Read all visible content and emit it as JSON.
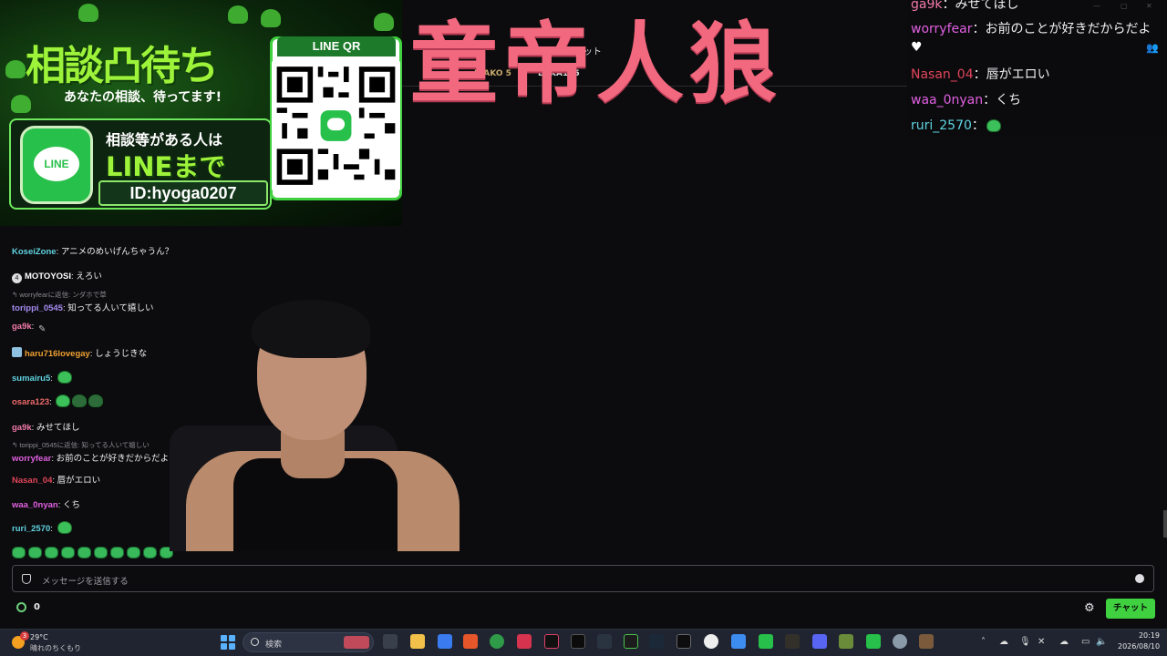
{
  "colors": {
    "accent": "#3fd13f",
    "title": "#f2687f",
    "line_green": "#27c04a",
    "background": "#0c0c0e"
  },
  "overlay_title": "童帝人狼",
  "header": {
    "chat_label": "チャット",
    "ranks": [
      {
        "name": "RIAKO",
        "count": "5"
      },
      {
        "name": "BEKA145",
        "count": ""
      }
    ]
  },
  "banner": {
    "title": "相談凸待ち",
    "subtitle": "あなたの相談、待ってます!",
    "line1": "相談等がある人は",
    "line2": "LINEまで",
    "id": "ID:hyoga0207",
    "qr_label": "LINE QR",
    "logo_text": "LINE"
  },
  "chat": {
    "messages": [
      {
        "user": "KoseiZone",
        "text": "アニメのめいげんちゃうん？",
        "color": "#5fd3e0"
      },
      {
        "user": "MOTOYOSI",
        "text": "えろい",
        "color": "#ffffff",
        "badge": "4"
      },
      {
        "reply": "worryfearに返信: ンダホで草"
      },
      {
        "user": "torippi_0545",
        "text": "知ってる人いて嬉しい",
        "color": "#a48cf0"
      },
      {
        "user": "ga9k",
        "text": "",
        "color": "#f27aa8",
        "emote": "pen"
      },
      {
        "user": "haru716lovegay",
        "text": "しょうじきな",
        "color": "#f0a030",
        "avatar": true
      },
      {
        "user": "sumairu5",
        "text": "",
        "color": "#5fd3e0",
        "emote": "ghost"
      },
      {
        "user": "osara123",
        "text": "",
        "color": "#f06a6a",
        "emote": "frogs"
      },
      {
        "user": "ga9k",
        "text": "みせてほし",
        "color": "#f27aa8"
      },
      {
        "reply": "torippi_0545に返信: 知ってる人いて嬉しい"
      },
      {
        "user": "worryfear",
        "text": "お前のことが好きだからだよ",
        "color": "#e060e0"
      },
      {
        "user": "Nasan_04",
        "text": "唇がエロい",
        "color": "#e0455a"
      },
      {
        "user": "waa_0nyan",
        "text": "くち",
        "color": "#e060e0"
      },
      {
        "user": "ruri_2570",
        "text": "",
        "color": "#5fd3e0",
        "emote": "ghost"
      }
    ]
  },
  "input": {
    "placeholder": "メッセージを送信する"
  },
  "points": {
    "value": "0"
  },
  "send_label": "チャット",
  "right_chat": [
    {
      "user": "ga9k",
      "text": "みせてほし",
      "color": "#f27aa8"
    },
    {
      "user": "worryfear",
      "text": "お前のことが好きだからだよ",
      "color": "#e060e0"
    },
    {
      "user": "Nasan_04",
      "text": "唇がエロい",
      "color": "#e0455a"
    },
    {
      "user": "waa_0nyan",
      "text": "くち",
      "color": "#e060e0"
    },
    {
      "user": "ruri_2570",
      "text": "",
      "color": "#5fd3e0",
      "emote": "ghost"
    }
  ],
  "taskbar": {
    "weather_temp": "29°C",
    "weather_desc": "晴れのちくもり",
    "weather_alert": "3",
    "search_placeholder": "検索",
    "time": "20:19",
    "date": "2026/08/10"
  }
}
